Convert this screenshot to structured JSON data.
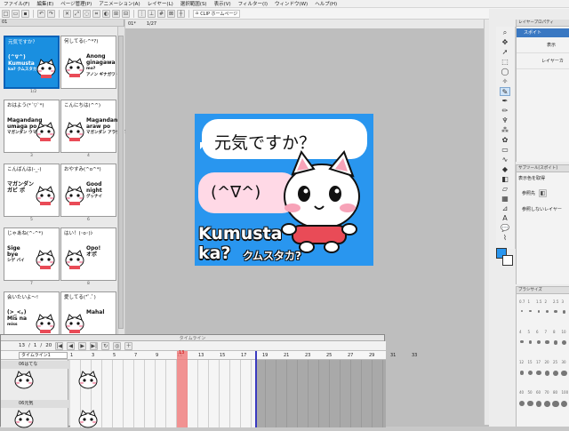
{
  "menu": [
    "ファイル(F)",
    "編集(E)",
    "ページ管理(P)",
    "アニメーション(A)",
    "レイヤー(L)",
    "選択範囲(S)",
    "表示(V)",
    "フィルター(I)",
    "ウィンドウ(W)",
    "ヘルプ(H)"
  ],
  "toolbar": {
    "homepage_label": "CLIP ホームページ"
  },
  "doc": {
    "tab_left": "01",
    "tab_page": "01*",
    "tab_zoom": "1/27"
  },
  "pages": [
    {
      "num": "1/2",
      "text1": "元気ですか？",
      "text2": "(^∇^)",
      "text3": "Kumusta",
      "text4": "ka? クムスタカ?",
      "selected": true
    },
    {
      "num": "",
      "text1": "何してる(-^*?)",
      "text2": "Anong",
      "text3": "ginagawa",
      "text4": "mo?",
      "text5": "アノン ギナガワ モ"
    },
    {
      "num": "3",
      "text1": "おはよう(*´▽`*)",
      "text2": "Magandang",
      "text3": "umaga po",
      "text4": "マガンダン ウマガ ポ"
    },
    {
      "num": "4",
      "text1": "こんにちは(^^)",
      "text2": "Magandang",
      "text3": "araw po",
      "text4": "マガンダン アラウ ポ"
    },
    {
      "num": "5",
      "text1": "こんばんは(-_-)",
      "text2": "マガンダン",
      "text3": "ガビ ポ"
    },
    {
      "num": "6",
      "text1": "おやすみ(^o^*)",
      "text2": "Good",
      "text3": "night",
      "text4": "グッナイ"
    },
    {
      "num": "7",
      "text1": "じゃあね(^-^*)",
      "text2": "Sige",
      "text3": "bye",
      "text4": "シゲ バイ"
    },
    {
      "num": "8",
      "text1": "はい！(･o･)ｼ",
      "text2": "Opo!",
      "text3": "オポ"
    },
    {
      "num": "",
      "text1": "会いたいよ～!",
      "text2": "(>_<。)",
      "text3": "Mis na",
      "text4": "miss"
    },
    {
      "num": "",
      "text1": "愛してる(*ﾟ.ﾟ)",
      "text2": "Mahal"
    }
  ],
  "artboard": {
    "bubble_top": "元気ですか？",
    "bubble_bottom": "(^∇^)",
    "kumusta": "Kumusta",
    "ka": "ka?",
    "katakana": "クムスタカ?",
    "bg_color": "#2996ef"
  },
  "timeline": {
    "title": "タイムライン",
    "frame": "13",
    "slash": "/",
    "start": "1",
    "slash2": "/",
    "end": "20",
    "track_name": "タイムライン1",
    "folder1": "06はてな",
    "folder2": "06元気",
    "ruler": [
      "1",
      "3",
      "5",
      "7",
      "9",
      "11",
      "13",
      "15",
      "17",
      "19",
      "21",
      "23",
      "25",
      "27",
      "29",
      "31",
      "33"
    ],
    "current_frame": "13"
  },
  "layer_panel": {
    "title": "レイヤープロパティ",
    "row1": "スポイト",
    "row2": "表示",
    "row3": "レイヤーカ"
  },
  "sub_panel": {
    "title": "サブツール[スポイト]",
    "row1": "表示色を取得",
    "row2": "参照先",
    "row3": "参照しないレイヤー"
  },
  "brush_panel": {
    "title": "ブラシサイズ",
    "sizes": [
      "0.7",
      "1",
      "1.5",
      "2",
      "2.5",
      "3",
      "4",
      "5",
      "6",
      "7",
      "8",
      "10",
      "12",
      "15",
      "17",
      "20",
      "25",
      "30",
      "40",
      "50",
      "60",
      "70",
      "80",
      "100"
    ]
  },
  "colors": {
    "accent": "#1a8fe0",
    "playhead": "#f08080",
    "artboard": "#2996ef"
  }
}
